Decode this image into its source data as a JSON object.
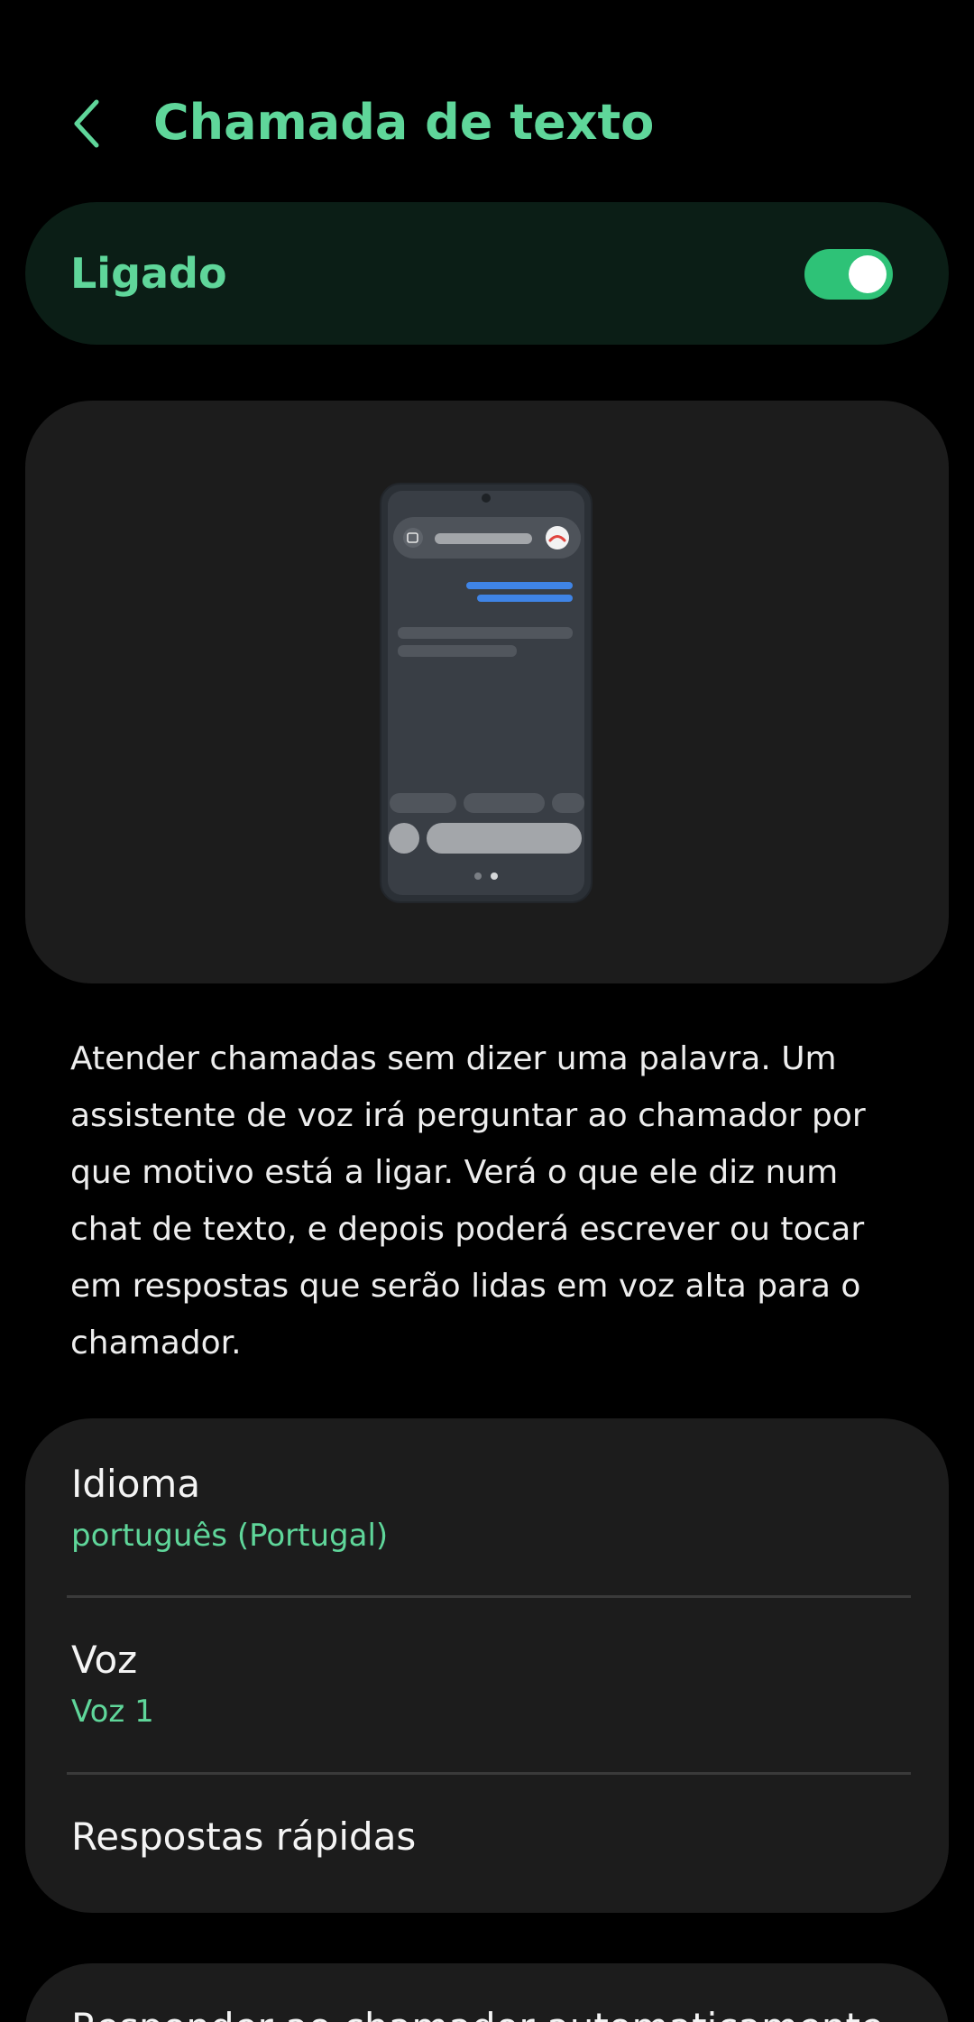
{
  "header": {
    "back_icon": "chevron-left-icon",
    "title": "Chamada de texto"
  },
  "master_switch": {
    "label": "Ligado",
    "state": "on",
    "accent_color": "#2ec277"
  },
  "illustration": {
    "description_icon": "phone-text-call-illustration"
  },
  "description": "Atender chamadas sem dizer uma palavra. Um assistente de voz irá perguntar ao chamador por que motivo está a ligar. Verá o que ele diz num chat de texto, e depois poderá escrever ou tocar em respostas que serão lidas em voz alta para o chamador.",
  "settings": {
    "items": [
      {
        "title": "Idioma",
        "value": "português (Portugal)"
      },
      {
        "title": "Voz",
        "value": "Voz 1"
      },
      {
        "title": "Respostas rápidas"
      }
    ]
  },
  "next_section": {
    "title": "Responder ao chamador automaticamente"
  },
  "colors": {
    "accent": "#5fd69a",
    "background": "#000000",
    "card": "#1c1c1c"
  }
}
